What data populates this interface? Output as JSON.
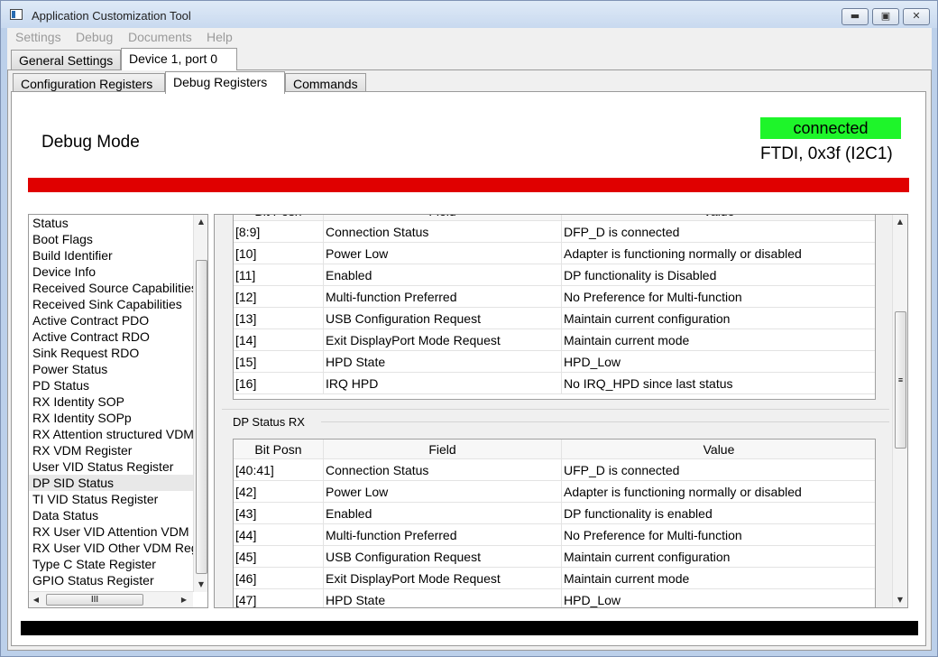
{
  "window": {
    "title": "Application Customization Tool"
  },
  "menu": [
    "Settings",
    "Debug",
    "Documents",
    "Help"
  ],
  "top_tabs": [
    {
      "label": "General Settings",
      "active": false
    },
    {
      "label": "Device 1, port 0",
      "active": true
    }
  ],
  "sub_tabs": [
    {
      "label": "Configuration Registers",
      "active": false
    },
    {
      "label": "Debug Registers",
      "active": true
    },
    {
      "label": "Commands",
      "active": false
    }
  ],
  "header": {
    "mode_title": "Debug Mode",
    "status": "connected",
    "connection_info": "FTDI, 0x3f (I2C1)",
    "status_color": "#1ef52a",
    "alert_bar_color": "#e00000"
  },
  "register_list": {
    "selected": "DP SID Status",
    "items": [
      "Status",
      "Boot Flags",
      "Build Identifier",
      "Device Info",
      "Received Source Capabilities",
      "Received Sink Capabilities",
      "Active Contract PDO",
      "Active Contract RDO",
      "Sink Request RDO",
      "Power Status",
      "PD Status",
      "RX Identity SOP",
      "RX Identity SOPp",
      "RX Attention structured VDM",
      "RX VDM Register",
      "User VID Status Register",
      "DP SID Status",
      "TI VID Status Register",
      "Data Status",
      "RX User VID Attention VDM Register",
      "RX User VID Other VDM Register",
      "Type C State Register",
      "GPIO Status Register"
    ],
    "hscroll_glyph": "III"
  },
  "columns": [
    "Bit Posn",
    "Field",
    "Value"
  ],
  "dp_status_tx": {
    "rows": [
      [
        "[8:9]",
        "Connection Status",
        "DFP_D is connected"
      ],
      [
        "[10]",
        "Power Low",
        "Adapter is functioning normally or disabled"
      ],
      [
        "[11]",
        "Enabled",
        "DP functionality is Disabled"
      ],
      [
        "[12]",
        "Multi-function Preferred",
        "No Preference for Multi-function"
      ],
      [
        "[13]",
        "USB Configuration Request",
        "Maintain current configuration"
      ],
      [
        "[14]",
        "Exit DisplayPort Mode Request",
        "Maintain current mode"
      ],
      [
        "[15]",
        "HPD State",
        "HPD_Low"
      ],
      [
        "[16]",
        "IRQ HPD",
        "No IRQ_HPD since last status"
      ]
    ]
  },
  "dp_status_rx": {
    "title": "DP Status RX",
    "rows": [
      [
        "[40:41]",
        "Connection Status",
        "UFP_D is connected"
      ],
      [
        "[42]",
        "Power Low",
        "Adapter is functioning normally or disabled"
      ],
      [
        "[43]",
        "Enabled",
        "DP functionality is enabled"
      ],
      [
        "[44]",
        "Multi-function Preferred",
        "No Preference for Multi-function"
      ],
      [
        "[45]",
        "USB Configuration Request",
        "Maintain current configuration"
      ],
      [
        "[46]",
        "Exit DisplayPort Mode Request",
        "Maintain current mode"
      ],
      [
        "[47]",
        "HPD State",
        "HPD_Low"
      ]
    ]
  }
}
